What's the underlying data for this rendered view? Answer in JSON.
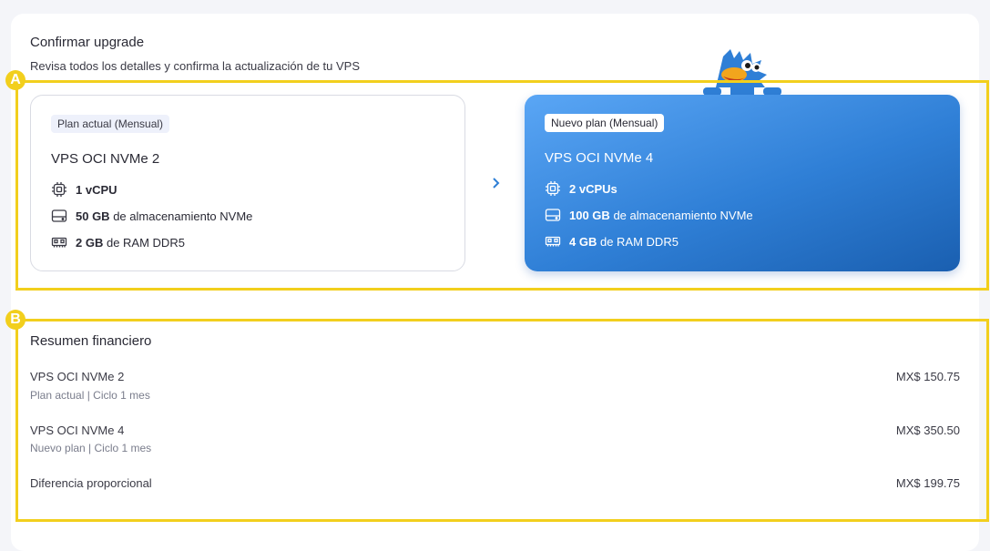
{
  "header": {
    "title": "Confirmar upgrade",
    "subtitle": "Revisa todos los detalles y confirma la actualización de tu VPS"
  },
  "annotations": {
    "a": "A",
    "b": "B"
  },
  "current_plan": {
    "tag": "Plan actual (Mensual)",
    "name": "VPS OCI NVMe 2",
    "cpu_value": "1 vCPU",
    "storage_value": "50 GB",
    "storage_label": "de almacenamiento NVMe",
    "ram_value": "2 GB",
    "ram_label": "de RAM DDR5"
  },
  "new_plan": {
    "tag": "Nuevo plan (Mensual)",
    "name": "VPS OCI NVMe 4",
    "cpu_value": "2 vCPUs",
    "storage_value": "100 GB",
    "storage_label": "de almacenamiento NVMe",
    "ram_value": "4 GB",
    "ram_label": "de RAM DDR5"
  },
  "financial": {
    "title": "Resumen financiero",
    "rows": [
      {
        "name": "VPS OCI NVMe 2",
        "sub": "Plan actual | Ciclo 1 mes",
        "price": "MX$ 150.75"
      },
      {
        "name": "VPS OCI NVMe 4",
        "sub": "Nuevo plan | Ciclo 1 mes",
        "price": "MX$ 350.50"
      },
      {
        "name": "Diferencia proporcional",
        "sub": "",
        "price": "MX$ 199.75"
      }
    ]
  },
  "icons": {
    "cpu": "cpu-icon",
    "storage": "storage-drive-icon",
    "ram": "ram-icon",
    "arrow": "chevron-right-icon",
    "mascot": "mascot-icon"
  },
  "colors": {
    "accent": "#2f7fd6",
    "highlight": "#f2cf1d",
    "text": "#2a2a35"
  }
}
